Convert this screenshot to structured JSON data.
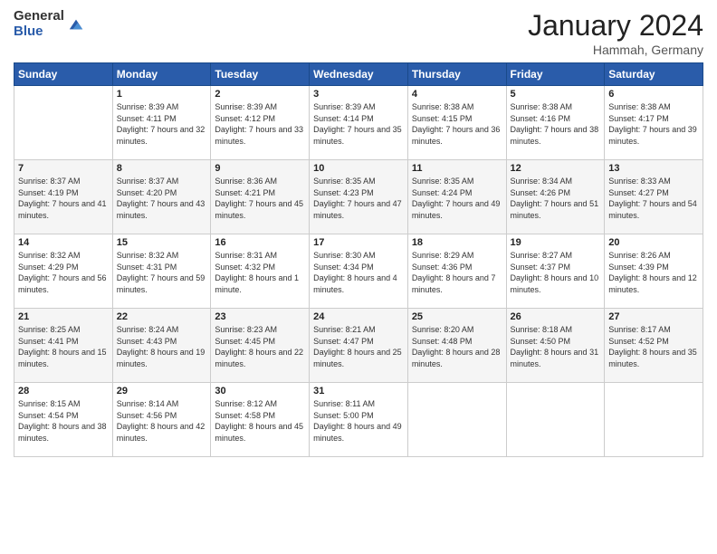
{
  "header": {
    "logo": {
      "general": "General",
      "blue": "Blue"
    },
    "title": "January 2024",
    "location": "Hammah, Germany"
  },
  "weekdays": [
    "Sunday",
    "Monday",
    "Tuesday",
    "Wednesday",
    "Thursday",
    "Friday",
    "Saturday"
  ],
  "weeks": [
    [
      {
        "day": "",
        "sunrise": "",
        "sunset": "",
        "daylight": ""
      },
      {
        "day": "1",
        "sunrise": "Sunrise: 8:39 AM",
        "sunset": "Sunset: 4:11 PM",
        "daylight": "Daylight: 7 hours and 32 minutes."
      },
      {
        "day": "2",
        "sunrise": "Sunrise: 8:39 AM",
        "sunset": "Sunset: 4:12 PM",
        "daylight": "Daylight: 7 hours and 33 minutes."
      },
      {
        "day": "3",
        "sunrise": "Sunrise: 8:39 AM",
        "sunset": "Sunset: 4:14 PM",
        "daylight": "Daylight: 7 hours and 35 minutes."
      },
      {
        "day": "4",
        "sunrise": "Sunrise: 8:38 AM",
        "sunset": "Sunset: 4:15 PM",
        "daylight": "Daylight: 7 hours and 36 minutes."
      },
      {
        "day": "5",
        "sunrise": "Sunrise: 8:38 AM",
        "sunset": "Sunset: 4:16 PM",
        "daylight": "Daylight: 7 hours and 38 minutes."
      },
      {
        "day": "6",
        "sunrise": "Sunrise: 8:38 AM",
        "sunset": "Sunset: 4:17 PM",
        "daylight": "Daylight: 7 hours and 39 minutes."
      }
    ],
    [
      {
        "day": "7",
        "sunrise": "Sunrise: 8:37 AM",
        "sunset": "Sunset: 4:19 PM",
        "daylight": "Daylight: 7 hours and 41 minutes."
      },
      {
        "day": "8",
        "sunrise": "Sunrise: 8:37 AM",
        "sunset": "Sunset: 4:20 PM",
        "daylight": "Daylight: 7 hours and 43 minutes."
      },
      {
        "day": "9",
        "sunrise": "Sunrise: 8:36 AM",
        "sunset": "Sunset: 4:21 PM",
        "daylight": "Daylight: 7 hours and 45 minutes."
      },
      {
        "day": "10",
        "sunrise": "Sunrise: 8:35 AM",
        "sunset": "Sunset: 4:23 PM",
        "daylight": "Daylight: 7 hours and 47 minutes."
      },
      {
        "day": "11",
        "sunrise": "Sunrise: 8:35 AM",
        "sunset": "Sunset: 4:24 PM",
        "daylight": "Daylight: 7 hours and 49 minutes."
      },
      {
        "day": "12",
        "sunrise": "Sunrise: 8:34 AM",
        "sunset": "Sunset: 4:26 PM",
        "daylight": "Daylight: 7 hours and 51 minutes."
      },
      {
        "day": "13",
        "sunrise": "Sunrise: 8:33 AM",
        "sunset": "Sunset: 4:27 PM",
        "daylight": "Daylight: 7 hours and 54 minutes."
      }
    ],
    [
      {
        "day": "14",
        "sunrise": "Sunrise: 8:32 AM",
        "sunset": "Sunset: 4:29 PM",
        "daylight": "Daylight: 7 hours and 56 minutes."
      },
      {
        "day": "15",
        "sunrise": "Sunrise: 8:32 AM",
        "sunset": "Sunset: 4:31 PM",
        "daylight": "Daylight: 7 hours and 59 minutes."
      },
      {
        "day": "16",
        "sunrise": "Sunrise: 8:31 AM",
        "sunset": "Sunset: 4:32 PM",
        "daylight": "Daylight: 8 hours and 1 minute."
      },
      {
        "day": "17",
        "sunrise": "Sunrise: 8:30 AM",
        "sunset": "Sunset: 4:34 PM",
        "daylight": "Daylight: 8 hours and 4 minutes."
      },
      {
        "day": "18",
        "sunrise": "Sunrise: 8:29 AM",
        "sunset": "Sunset: 4:36 PM",
        "daylight": "Daylight: 8 hours and 7 minutes."
      },
      {
        "day": "19",
        "sunrise": "Sunrise: 8:27 AM",
        "sunset": "Sunset: 4:37 PM",
        "daylight": "Daylight: 8 hours and 10 minutes."
      },
      {
        "day": "20",
        "sunrise": "Sunrise: 8:26 AM",
        "sunset": "Sunset: 4:39 PM",
        "daylight": "Daylight: 8 hours and 12 minutes."
      }
    ],
    [
      {
        "day": "21",
        "sunrise": "Sunrise: 8:25 AM",
        "sunset": "Sunset: 4:41 PM",
        "daylight": "Daylight: 8 hours and 15 minutes."
      },
      {
        "day": "22",
        "sunrise": "Sunrise: 8:24 AM",
        "sunset": "Sunset: 4:43 PM",
        "daylight": "Daylight: 8 hours and 19 minutes."
      },
      {
        "day": "23",
        "sunrise": "Sunrise: 8:23 AM",
        "sunset": "Sunset: 4:45 PM",
        "daylight": "Daylight: 8 hours and 22 minutes."
      },
      {
        "day": "24",
        "sunrise": "Sunrise: 8:21 AM",
        "sunset": "Sunset: 4:47 PM",
        "daylight": "Daylight: 8 hours and 25 minutes."
      },
      {
        "day": "25",
        "sunrise": "Sunrise: 8:20 AM",
        "sunset": "Sunset: 4:48 PM",
        "daylight": "Daylight: 8 hours and 28 minutes."
      },
      {
        "day": "26",
        "sunrise": "Sunrise: 8:18 AM",
        "sunset": "Sunset: 4:50 PM",
        "daylight": "Daylight: 8 hours and 31 minutes."
      },
      {
        "day": "27",
        "sunrise": "Sunrise: 8:17 AM",
        "sunset": "Sunset: 4:52 PM",
        "daylight": "Daylight: 8 hours and 35 minutes."
      }
    ],
    [
      {
        "day": "28",
        "sunrise": "Sunrise: 8:15 AM",
        "sunset": "Sunset: 4:54 PM",
        "daylight": "Daylight: 8 hours and 38 minutes."
      },
      {
        "day": "29",
        "sunrise": "Sunrise: 8:14 AM",
        "sunset": "Sunset: 4:56 PM",
        "daylight": "Daylight: 8 hours and 42 minutes."
      },
      {
        "day": "30",
        "sunrise": "Sunrise: 8:12 AM",
        "sunset": "Sunset: 4:58 PM",
        "daylight": "Daylight: 8 hours and 45 minutes."
      },
      {
        "day": "31",
        "sunrise": "Sunrise: 8:11 AM",
        "sunset": "Sunset: 5:00 PM",
        "daylight": "Daylight: 8 hours and 49 minutes."
      },
      {
        "day": "",
        "sunrise": "",
        "sunset": "",
        "daylight": ""
      },
      {
        "day": "",
        "sunrise": "",
        "sunset": "",
        "daylight": ""
      },
      {
        "day": "",
        "sunrise": "",
        "sunset": "",
        "daylight": ""
      }
    ]
  ]
}
